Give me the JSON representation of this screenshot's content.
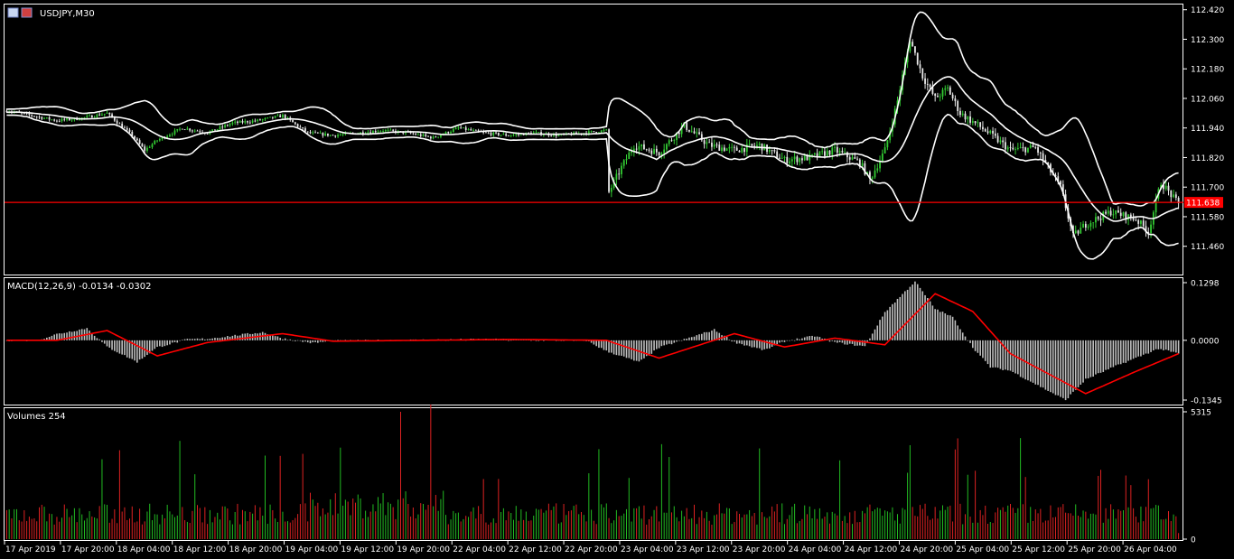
{
  "window": {
    "title": "USDJPY,M30",
    "icon": "chart-window-icon"
  },
  "colors": {
    "background": "#000000",
    "frame": "#ffffff",
    "bull_candle": "#33cc33",
    "bear_candle": "#e8e8e8",
    "bands": "#ffffff",
    "price_line": "#ff0000",
    "macd_hist": "#c0c0c0",
    "macd_signal": "#ff0000",
    "volume_up": "#22bb22",
    "volume_down": "#dd2222"
  },
  "chart_data": [
    {
      "type": "candlestick",
      "title": "USDJPY,M30",
      "ylim": [
        111.36,
        112.43
      ],
      "yticks": [
        "112.420",
        "112.300",
        "112.180",
        "112.060",
        "111.940",
        "111.820",
        "111.700",
        "111.580",
        "111.460"
      ],
      "current_price": "111.638",
      "indicators": [
        "Bollinger Bands"
      ],
      "close_keypoints": [
        [
          0,
          112.01
        ],
        [
          10,
          111.99
        ],
        [
          20,
          111.97
        ],
        [
          30,
          111.98
        ],
        [
          40,
          112.0
        ],
        [
          50,
          111.91
        ],
        [
          55,
          111.85
        ],
        [
          60,
          111.89
        ],
        [
          70,
          111.94
        ],
        [
          80,
          111.92
        ],
        [
          90,
          111.96
        ],
        [
          100,
          111.97
        ],
        [
          110,
          111.99
        ],
        [
          120,
          111.92
        ],
        [
          130,
          111.91
        ],
        [
          140,
          111.92
        ],
        [
          150,
          111.93
        ],
        [
          160,
          111.92
        ],
        [
          170,
          111.9
        ],
        [
          180,
          111.94
        ],
        [
          190,
          111.92
        ],
        [
          200,
          111.91
        ],
        [
          210,
          111.92
        ],
        [
          220,
          111.91
        ],
        [
          230,
          111.92
        ],
        [
          239,
          111.93
        ],
        [
          240,
          111.68
        ],
        [
          245,
          111.78
        ],
        [
          250,
          111.87
        ],
        [
          260,
          111.84
        ],
        [
          270,
          111.95
        ],
        [
          280,
          111.87
        ],
        [
          290,
          111.85
        ],
        [
          300,
          111.87
        ],
        [
          310,
          111.81
        ],
        [
          320,
          111.82
        ],
        [
          330,
          111.85
        ],
        [
          340,
          111.8
        ],
        [
          344,
          111.73
        ],
        [
          350,
          111.85
        ],
        [
          355,
          112.05
        ],
        [
          360,
          112.3
        ],
        [
          365,
          112.15
        ],
        [
          370,
          112.06
        ],
        [
          375,
          112.1
        ],
        [
          380,
          112.0
        ],
        [
          390,
          111.93
        ],
        [
          400,
          111.85
        ],
        [
          410,
          111.86
        ],
        [
          420,
          111.7
        ],
        [
          425,
          111.5
        ],
        [
          430,
          111.55
        ],
        [
          440,
          111.6
        ],
        [
          450,
          111.57
        ],
        [
          455,
          111.52
        ],
        [
          460,
          111.72
        ],
        [
          467,
          111.63
        ]
      ]
    },
    {
      "type": "histogram+line",
      "title": "MACD(12,26,9) -0.0134 -0.0302",
      "ylim": [
        -0.1345,
        0.1298
      ],
      "yticks": [
        "0.1298",
        "0.0000",
        "-0.1345"
      ],
      "signal_keypoints": [
        [
          0,
          0.0
        ],
        [
          20,
          0.0
        ],
        [
          40,
          0.022
        ],
        [
          60,
          -0.035
        ],
        [
          80,
          -0.005
        ],
        [
          110,
          0.015
        ],
        [
          130,
          -0.002
        ],
        [
          200,
          0.002
        ],
        [
          239,
          0.0
        ],
        [
          260,
          -0.04
        ],
        [
          290,
          0.015
        ],
        [
          310,
          -0.015
        ],
        [
          330,
          0.005
        ],
        [
          350,
          -0.01
        ],
        [
          370,
          0.105
        ],
        [
          385,
          0.065
        ],
        [
          400,
          -0.03
        ],
        [
          430,
          -0.12
        ],
        [
          450,
          -0.07
        ],
        [
          467,
          -0.03
        ]
      ]
    },
    {
      "type": "bar",
      "title": "Volumes 254",
      "ylim": [
        0,
        5315
      ],
      "yticks": [
        "5315",
        "0"
      ],
      "last_value": 254
    }
  ],
  "xaxis": {
    "labels": [
      "17 Apr 2019",
      "17 Apr 20:00",
      "18 Apr 04:00",
      "18 Apr 12:00",
      "18 Apr 20:00",
      "19 Apr 04:00",
      "19 Apr 12:00",
      "19 Apr 20:00",
      "22 Apr 04:00",
      "22 Apr 12:00",
      "22 Apr 20:00",
      "23 Apr 04:00",
      "23 Apr 12:00",
      "23 Apr 20:00",
      "24 Apr 04:00",
      "24 Apr 12:00",
      "24 Apr 20:00",
      "25 Apr 04:00",
      "25 Apr 12:00",
      "25 Apr 20:00",
      "26 Apr 04:00"
    ]
  }
}
